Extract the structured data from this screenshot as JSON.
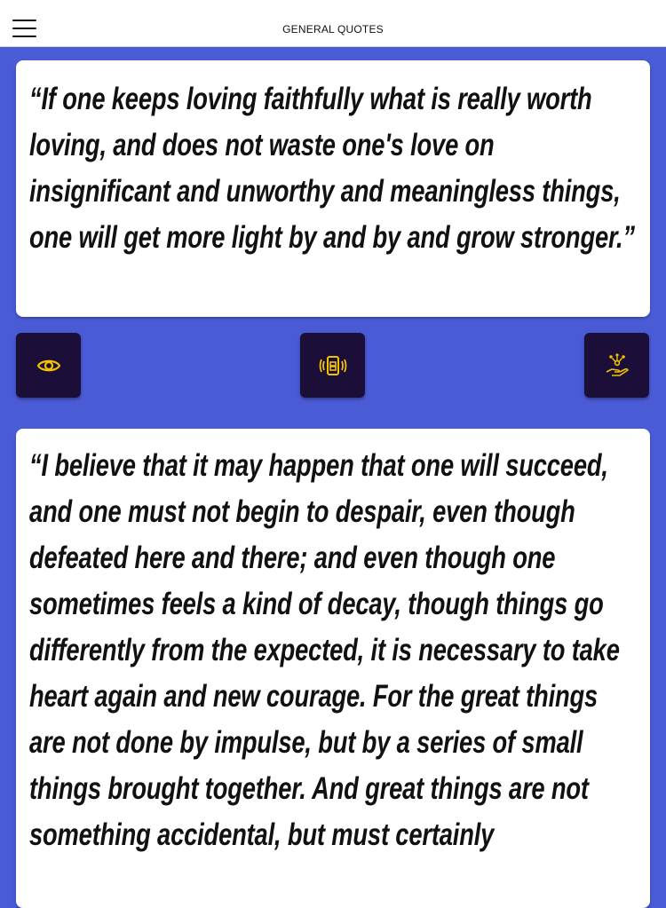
{
  "header": {
    "title": "GENERAL QUOTES"
  },
  "quotes": [
    {
      "text": "“If one keeps loving faithfully what is really worth loving, and does not waste one's love on insignificant and unworthy and meaningless things, one will get more light by and by and grow stronger.”"
    },
    {
      "text": "“I believe that it may happen that one will succeed, and one must not begin to despair, even though defeated here and there; and even though one sometimes feels a kind of decay, though things go differently from the expected, it is necessary to take heart again and new courage. For the great things are not done by impulse, but by a series of small things brought together. And great things are not something accidental, but must certainly"
    }
  ],
  "actions": {
    "view_icon": "eye-icon",
    "vibrate_icon": "phone-vibrate-icon",
    "share_icon": "hand-share-icon"
  },
  "colors": {
    "background": "#4a5bd6",
    "button_bg": "#1b0f3a",
    "icon_accent": "#f2c200",
    "card_bg": "#ffffff"
  }
}
